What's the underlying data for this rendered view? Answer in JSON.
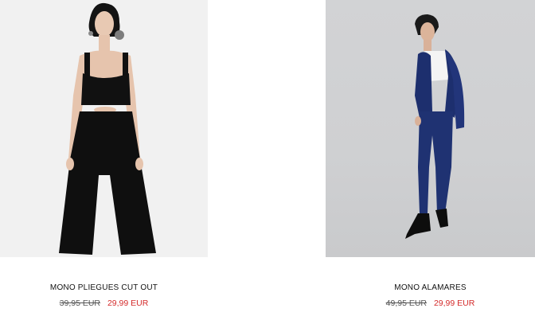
{
  "products": [
    {
      "name": "MONO PLIEGUES CUT OUT",
      "old_price": "39,95 EUR",
      "sale_price": "29,99 EUR"
    },
    {
      "name": "MONO ALAMARES",
      "old_price": "49,95 EUR",
      "sale_price": "29,99 EUR"
    }
  ],
  "colors": {
    "sale_price": "#d42b2b",
    "text": "#111111",
    "left_photo_bg": "#f1f1f1",
    "right_photo_bg": "#d0d1d3"
  }
}
